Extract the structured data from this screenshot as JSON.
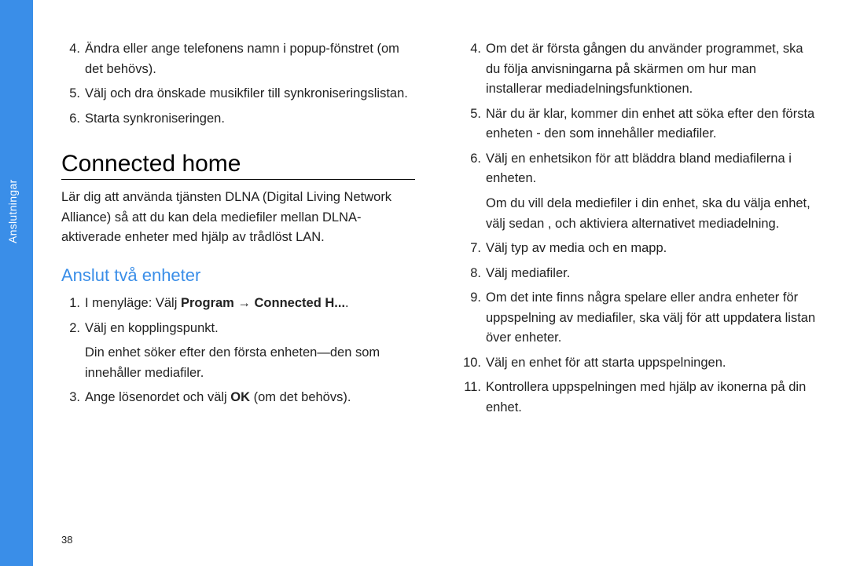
{
  "sideTab": {
    "label": "Anslutningar"
  },
  "leftCol": {
    "topList": [
      {
        "n": "4.",
        "t": "Ändra eller ange telefonens namn i popup-fönstret (om det behövs)."
      },
      {
        "n": "5.",
        "t": "Välj och dra önskade musikfiler till synkroniseringslistan."
      },
      {
        "n": "6.",
        "t": "Starta synkroniseringen."
      }
    ],
    "h1": "Connected home",
    "intro": "Lär dig att använda tjänsten DLNA (Digital Living Network Alliance) så att du kan dela mediefiler mellan DLNA-aktiverade enheter med hjälp av trådlöst LAN.",
    "h2": "Anslut två enheter",
    "steps": {
      "s1": {
        "n": "1.",
        "pre": "I menyläge: Välj ",
        "bold1": "Program",
        "arrow": " → ",
        "bold2": "Connected H...",
        "post": "."
      },
      "s2": {
        "n": "2.",
        "t": "Välj en kopplingspunkt."
      },
      "s2sub": "Din enhet söker efter den första enheten—den som innehåller mediafiler.",
      "s3": {
        "n": "3.",
        "pre": "Ange lösenordet och välj ",
        "bold": "OK",
        "post": " (om det behövs)."
      }
    }
  },
  "rightCol": {
    "list": [
      {
        "n": "4.",
        "t": "Om det är första gången du använder programmet, ska du följa anvisningarna på skärmen om hur man installerar mediadelningsfunktionen."
      },
      {
        "n": "5.",
        "t": "När du är klar, kommer din enhet att söka efter den första enheten - den som innehåller mediafiler."
      },
      {
        "n": "6.",
        "t": "Välj en enhetsikon för att bläddra bland mediafilerna i enheten."
      }
    ],
    "sub6": "Om du vill dela mediefiler i din enhet, ska du välja enhet, välj sedan      , och aktiviera alternativet mediadelning.",
    "list2": [
      {
        "n": "7.",
        "t": "Välj typ av media och en mapp."
      },
      {
        "n": "8.",
        "t": "Välj mediafiler."
      },
      {
        "n": "9.",
        "t": "Om det inte finns några spelare eller andra enheter för uppspelning av mediafiler, ska välj       för att uppdatera listan över enheter."
      },
      {
        "n": "10.",
        "t": "Välj en enhet för att starta uppspelningen."
      },
      {
        "n": "11.",
        "t": "Kontrollera uppspelningen med hjälp av ikonerna på din enhet."
      }
    ]
  },
  "pageNum": "38"
}
